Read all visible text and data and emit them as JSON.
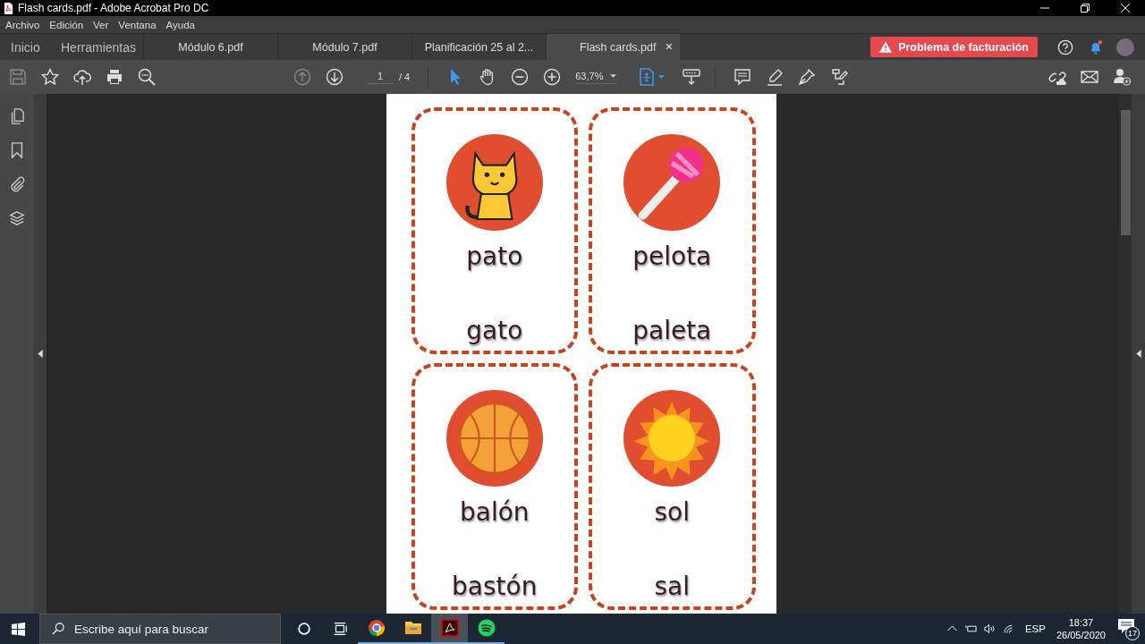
{
  "window": {
    "title": "Flash cards.pdf - Adobe Acrobat Pro DC"
  },
  "menu": [
    "Archivo",
    "Edición",
    "Ver",
    "Ventana",
    "Ayuda"
  ],
  "nav": [
    "Inicio",
    "Herramientas"
  ],
  "tabs": [
    {
      "label": "Módulo 6.pdf",
      "selected": false
    },
    {
      "label": "Módulo 7.pdf",
      "selected": false
    },
    {
      "label": "Planificación 25 al 2...",
      "selected": false
    },
    {
      "label": "Flash cards.pdf",
      "selected": true,
      "close": "×"
    }
  ],
  "billing_button": "Problema de facturación",
  "notifications": {
    "unread": true
  },
  "toolbar": {
    "page_current": "1",
    "page_total": "/ 4",
    "zoom": "63,7%"
  },
  "cards": [
    {
      "word": "pato",
      "answer": "gato"
    },
    {
      "word": "pelota",
      "answer": "paleta"
    },
    {
      "word": "balón",
      "answer": "bastón"
    },
    {
      "word": "sol",
      "answer": "sal"
    }
  ],
  "taskbar": {
    "search_placeholder": "Escribe aquí para buscar",
    "apps": [
      {
        "open": true,
        "selected": false
      },
      {
        "open": true,
        "selected": false
      },
      {
        "open": true,
        "selected": true
      },
      {
        "open": true,
        "selected": false
      }
    ],
    "language": "ESP",
    "time": "18:37",
    "date": "26/05/2020",
    "notification_count": "17"
  }
}
